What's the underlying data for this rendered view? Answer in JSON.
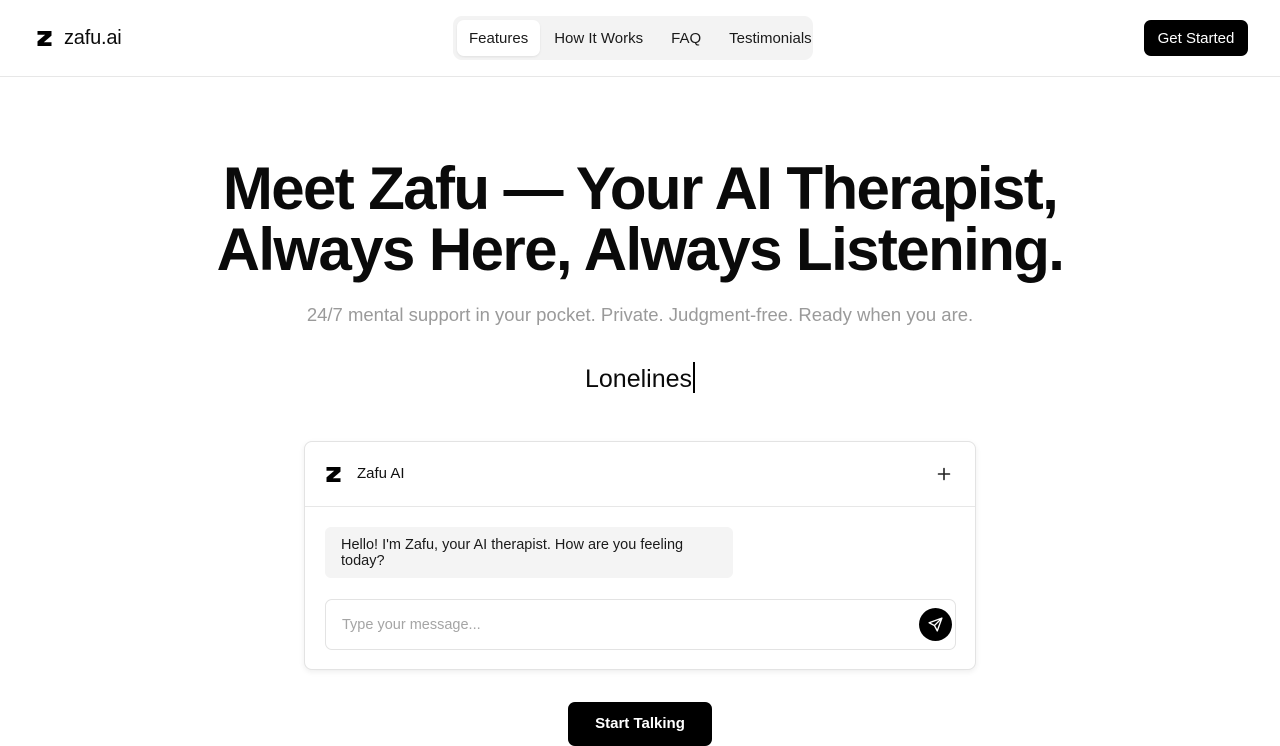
{
  "brand": {
    "name": "zafu.ai",
    "logo_icon": "zafu-logo-icon"
  },
  "nav": {
    "items": [
      {
        "label": "Features",
        "active": true
      },
      {
        "label": "How It Works",
        "active": false
      },
      {
        "label": "FAQ",
        "active": false
      },
      {
        "label": "Testimonials",
        "active": false
      }
    ]
  },
  "header": {
    "cta_label": "Get Started"
  },
  "hero": {
    "title_line1": "Meet Zafu — Your AI Therapist,",
    "title_line2": "Always Here, Always Listening.",
    "subtitle": "24/7 mental support in your pocket. Private. Judgment-free. Ready when you are.",
    "typing_text": "Lonelines"
  },
  "chat": {
    "title": "Zafu AI",
    "new_chat_icon": "plus-icon",
    "messages": [
      {
        "from": "assistant",
        "text": "Hello! I'm Zafu, your AI therapist. How are you feeling today?"
      }
    ],
    "input_placeholder": "Type your message...",
    "send_icon": "send-icon"
  },
  "cta": {
    "start_label": "Start Talking"
  },
  "colors": {
    "primary": "#000000",
    "background": "#ffffff",
    "nav_background": "#f3f3f3",
    "muted_text": "#9a9a9a",
    "bubble_background": "#f4f4f4"
  }
}
